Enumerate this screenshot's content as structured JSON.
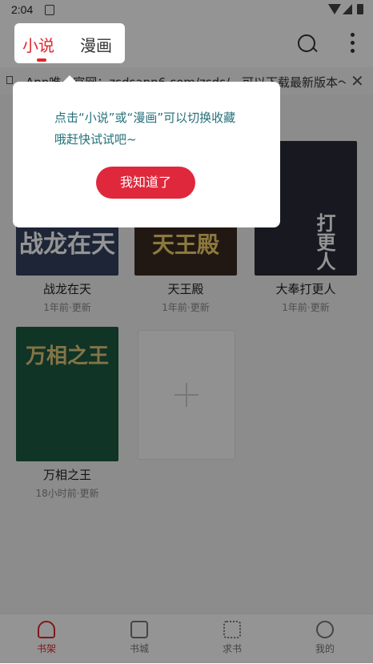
{
  "status_bar": {
    "time": "2:04"
  },
  "header": {
    "tabs": [
      {
        "label": "小说"
      },
      {
        "label": "漫画"
      }
    ]
  },
  "notice": {
    "text": "App唯一官网：zsdsapp6.com/zsds/，可以下载最新版本～"
  },
  "books": [
    {
      "cover_text": "战龙在天",
      "title": "战龙在天",
      "updated": "1年前·更新",
      "cover_color": "#33415e"
    },
    {
      "cover_text": "天王殿",
      "title": "天王殿",
      "updated": "1年前·更新",
      "cover_color": "#3b2a22"
    },
    {
      "cover_text": "打更人",
      "title": "大奉打更人",
      "updated": "1年前·更新",
      "cover_color": "#2a2a3a"
    },
    {
      "cover_text": "万相之王",
      "title": "万相之王",
      "updated": "18小时前·更新",
      "cover_color": "#1d5a43"
    }
  ],
  "bottom_nav": {
    "items": [
      {
        "label": "书架"
      },
      {
        "label": "书城"
      },
      {
        "label": "求书"
      },
      {
        "label": "我的"
      }
    ]
  },
  "dialog": {
    "message": "点击“小说”或“漫画”可以切换收藏哦赶快试试吧~",
    "button_label": "我知道了"
  },
  "colors": {
    "accent": "#e0282c",
    "tip_text": "#24707a"
  }
}
